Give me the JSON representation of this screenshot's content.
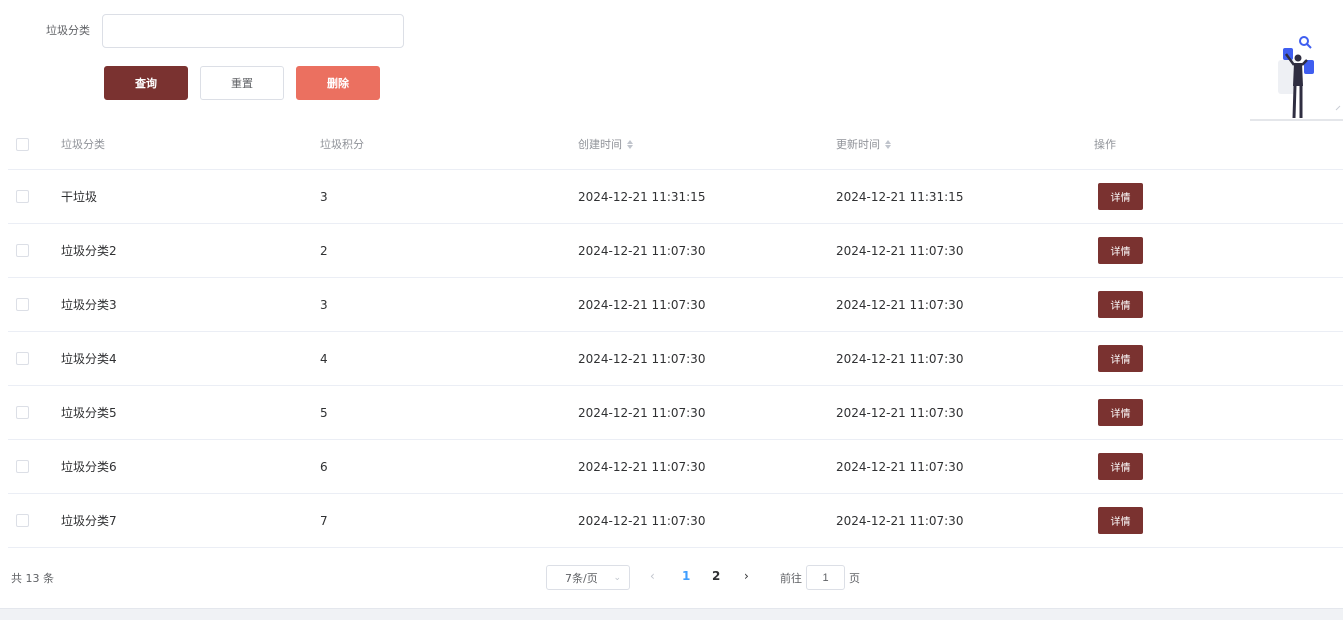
{
  "search": {
    "label": "垃圾分类",
    "value": "",
    "placeholder": ""
  },
  "buttons": {
    "query": "查询",
    "reset": "重置",
    "delete": "删除"
  },
  "colors": {
    "primary": "#7a3230",
    "danger": "#eb7060",
    "active_page": "#409eff"
  },
  "table": {
    "headers": {
      "name": "垃圾分类",
      "score": "垃圾积分",
      "created": "创建时间",
      "updated": "更新时间",
      "op": "操作"
    },
    "detail_label": "详情",
    "rows": [
      {
        "name": "干垃圾",
        "score": "3",
        "created": "2024-12-21 11:31:15",
        "updated": "2024-12-21 11:31:15"
      },
      {
        "name": "垃圾分类2",
        "score": "2",
        "created": "2024-12-21 11:07:30",
        "updated": "2024-12-21 11:07:30"
      },
      {
        "name": "垃圾分类3",
        "score": "3",
        "created": "2024-12-21 11:07:30",
        "updated": "2024-12-21 11:07:30"
      },
      {
        "name": "垃圾分类4",
        "score": "4",
        "created": "2024-12-21 11:07:30",
        "updated": "2024-12-21 11:07:30"
      },
      {
        "name": "垃圾分类5",
        "score": "5",
        "created": "2024-12-21 11:07:30",
        "updated": "2024-12-21 11:07:30"
      },
      {
        "name": "垃圾分类6",
        "score": "6",
        "created": "2024-12-21 11:07:30",
        "updated": "2024-12-21 11:07:30"
      },
      {
        "name": "垃圾分类7",
        "score": "7",
        "created": "2024-12-21 11:07:30",
        "updated": "2024-12-21 11:07:30"
      }
    ]
  },
  "pagination": {
    "total": "共 13 条",
    "page_size": "7条/页",
    "pages": [
      "1",
      "2"
    ],
    "current_page": "1",
    "goto_label": "前往",
    "goto_value": "1",
    "goto_suffix": "页"
  }
}
